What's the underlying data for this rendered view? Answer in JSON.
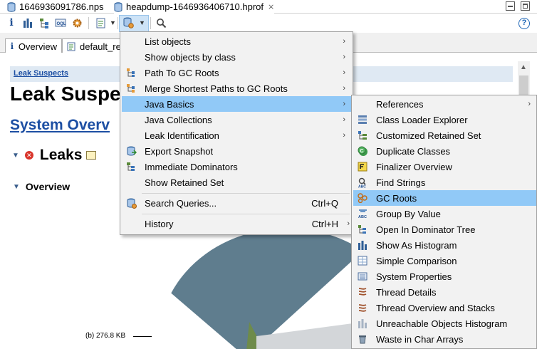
{
  "tabs": [
    {
      "label": "1646936091786.nps",
      "closable": false
    },
    {
      "label": "heapdump-1646936406710.hprof",
      "closable": true
    }
  ],
  "toolbar": {
    "items": [
      "info-icon",
      "histogram-icon",
      "dominator-tree-icon",
      "oql-icon",
      "gear-icon",
      "report-icon",
      "query-browser-icon",
      "search-icon"
    ],
    "help_label": "?"
  },
  "subtabs": [
    {
      "label": "Overview",
      "icon": "i"
    },
    {
      "label": "default_re",
      "icon": "report-icon"
    }
  ],
  "report": {
    "breadcrumb": "Leak Suspects",
    "title": "Leak Suspe",
    "section": "System Overv",
    "leaks_heading": "Leaks",
    "overview_heading": "Overview",
    "pie_label": "(b)  276.8 KB"
  },
  "menu_main": {
    "items": [
      {
        "label": "List objects",
        "accel": "",
        "submenu": true,
        "icon": ""
      },
      {
        "label": "Show objects by class",
        "accel": "",
        "submenu": true,
        "icon": ""
      },
      {
        "label": "Path To GC Roots",
        "accel": "",
        "submenu": true,
        "icon": "path-to-gc-roots-icon"
      },
      {
        "label": "Merge Shortest Paths to GC Roots",
        "accel": "",
        "submenu": true,
        "icon": "merge-paths-icon"
      },
      {
        "label": "Java Basics",
        "accel": "",
        "submenu": true,
        "icon": "",
        "highlighted": true
      },
      {
        "label": "Java Collections",
        "accel": "",
        "submenu": true,
        "icon": ""
      },
      {
        "label": "Leak Identification",
        "accel": "",
        "submenu": true,
        "icon": ""
      },
      {
        "label": "Export Snapshot",
        "accel": "",
        "submenu": false,
        "icon": "export-snapshot-icon"
      },
      {
        "label": "Immediate Dominators",
        "accel": "",
        "submenu": false,
        "icon": "immediate-dominators-icon"
      },
      {
        "label": "Show Retained Set",
        "accel": "",
        "submenu": false,
        "icon": ""
      },
      {
        "label": "Search Queries...",
        "accel": "Ctrl+Q",
        "submenu": false,
        "icon": "search-queries-icon"
      },
      {
        "label": "History",
        "accel": "Ctrl+H",
        "submenu": true,
        "icon": ""
      }
    ]
  },
  "menu_java_basics": {
    "items": [
      {
        "label": "References",
        "submenu": true,
        "icon": ""
      },
      {
        "label": "Class Loader Explorer",
        "submenu": false,
        "icon": "class-loader-explorer-icon"
      },
      {
        "label": "Customized Retained Set",
        "submenu": false,
        "icon": "customized-retained-set-icon"
      },
      {
        "label": "Duplicate Classes",
        "submenu": false,
        "icon": "duplicate-classes-icon"
      },
      {
        "label": "Finalizer Overview",
        "submenu": false,
        "icon": "finalizer-overview-icon"
      },
      {
        "label": "Find Strings",
        "submenu": false,
        "icon": "find-strings-icon"
      },
      {
        "label": "GC Roots",
        "submenu": false,
        "icon": "gc-roots-icon",
        "highlighted": true
      },
      {
        "label": "Group By Value",
        "submenu": false,
        "icon": "group-by-value-icon"
      },
      {
        "label": "Open In Dominator Tree",
        "submenu": false,
        "icon": "open-in-dominator-tree-icon"
      },
      {
        "label": "Show As Histogram",
        "submenu": false,
        "icon": "show-as-histogram-icon"
      },
      {
        "label": "Simple Comparison",
        "submenu": false,
        "icon": "simple-comparison-icon"
      },
      {
        "label": "System Properties",
        "submenu": false,
        "icon": "system-properties-icon"
      },
      {
        "label": "Thread Details",
        "submenu": false,
        "icon": "thread-details-icon"
      },
      {
        "label": "Thread Overview and Stacks",
        "submenu": false,
        "icon": "thread-overview-icon"
      },
      {
        "label": "Unreachable Objects Histogram",
        "submenu": false,
        "icon": "unreachable-objects-icon"
      },
      {
        "label": "Waste in Char Arrays",
        "submenu": false,
        "icon": "waste-in-char-arrays-icon"
      }
    ]
  },
  "colors": {
    "menu_highlight": "#91c9f7",
    "menu_bg": "#f2f2f2",
    "link": "#1d4fa3",
    "pie_main": "#5f7d8e",
    "pie_green": "#6e8b4a",
    "pie_light": "#d3d6d9"
  }
}
